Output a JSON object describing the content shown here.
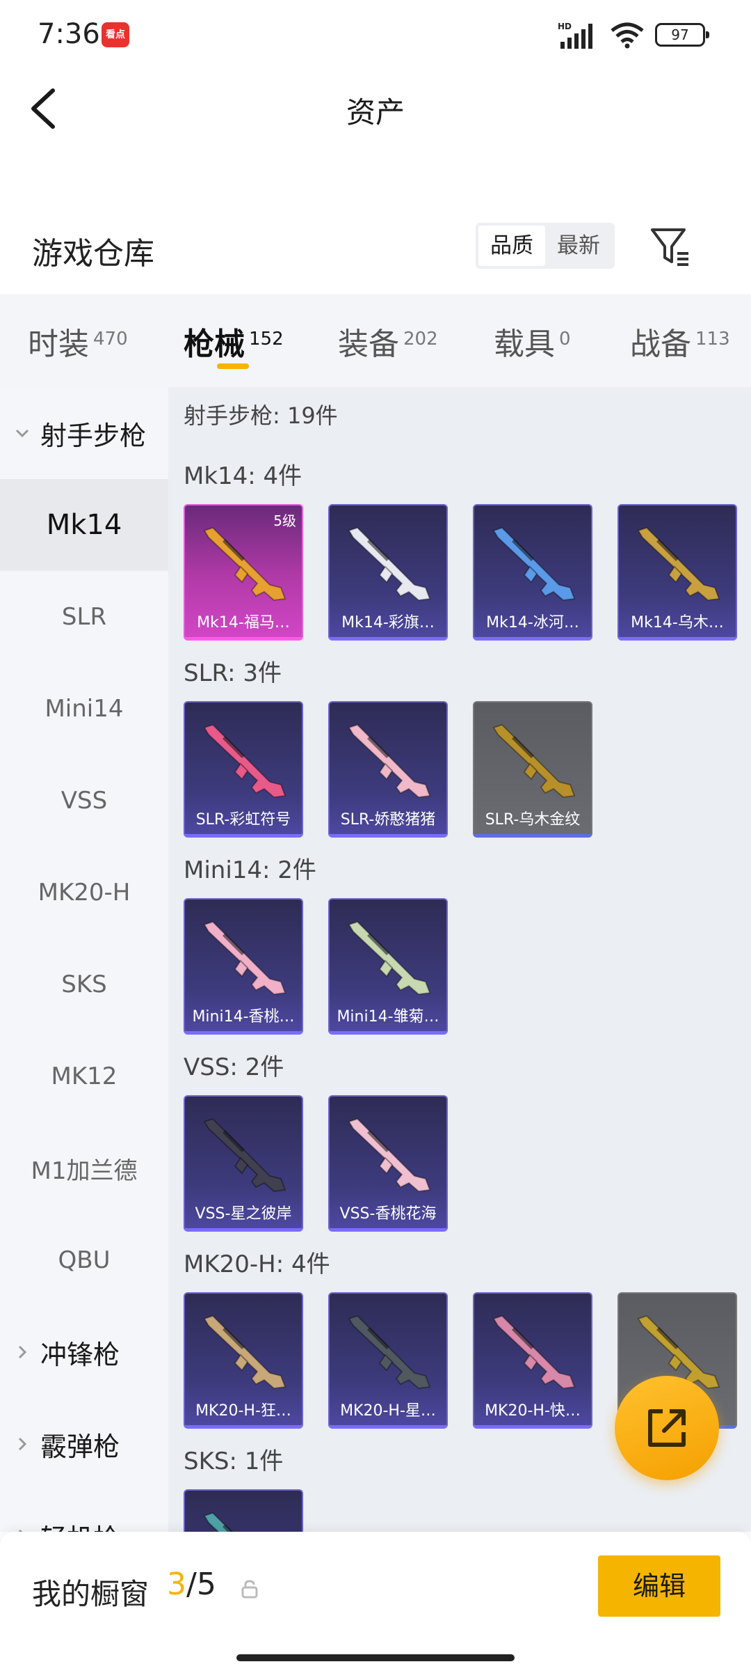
{
  "status_bar": {
    "time": "7:36",
    "news_app_label": "看点",
    "battery": "97",
    "icons": [
      "hd-signal-icon",
      "wifi-icon",
      "battery-icon"
    ]
  },
  "header": {
    "title": "资产",
    "back_icon": "chevron-left-icon"
  },
  "warehouse": {
    "title": "游戏仓库",
    "sort_options": [
      "品质",
      "最新"
    ],
    "sort_selected": "品质",
    "filter_icon": "filter-icon"
  },
  "tabs": [
    {
      "label": "时装",
      "count": "470"
    },
    {
      "label": "枪械",
      "count": "152"
    },
    {
      "label": "装备",
      "count": "202"
    },
    {
      "label": "载具",
      "count": "0"
    },
    {
      "label": "战备",
      "count": "113"
    }
  ],
  "active_tab": "枪械",
  "sidebar": {
    "groups": [
      {
        "label": "射手步枪",
        "expanded": true
      },
      {
        "label": "冲锋枪",
        "expanded": false
      },
      {
        "label": "霰弹枪",
        "expanded": false
      },
      {
        "label": "轻机枪",
        "expanded": false
      }
    ],
    "items": [
      "Mk14",
      "SLR",
      "Mini14",
      "VSS",
      "MK20-H",
      "SKS",
      "MK12",
      "M1加兰德",
      "QBU"
    ],
    "active_item": "Mk14"
  },
  "content": {
    "section_title": "射手步枪: 19件",
    "groups": [
      {
        "title": "Mk14: 4件",
        "cards": [
          {
            "name": "Mk14-福马…",
            "level": "5级",
            "rarity": "pink",
            "gun_color": "#e8a030"
          },
          {
            "name": "Mk14-彩旗…",
            "rarity": "purple",
            "gun_color": "#e8e8f0"
          },
          {
            "name": "Mk14-冰河…",
            "rarity": "purple",
            "gun_color": "#5a9ae8"
          },
          {
            "name": "Mk14-乌木…",
            "rarity": "purple",
            "gun_color": "#c8a040"
          }
        ]
      },
      {
        "title": "SLR: 3件",
        "cards": [
          {
            "name": "SLR-彩虹符号",
            "rarity": "purple",
            "gun_color": "#e85a8a"
          },
          {
            "name": "SLR-娇憨猪猪",
            "rarity": "purple",
            "gun_color": "#f0b8c8"
          },
          {
            "name": "SLR-乌木金纹",
            "rarity": "gray",
            "gun_color": "#b8902a"
          }
        ]
      },
      {
        "title": "Mini14: 2件",
        "cards": [
          {
            "name": "Mini14-香桃…",
            "rarity": "purple",
            "gun_color": "#f0b0c8"
          },
          {
            "name": "Mini14-雏菊…",
            "rarity": "purple",
            "gun_color": "#c8d8b0"
          }
        ]
      },
      {
        "title": "VSS: 2件",
        "cards": [
          {
            "name": "VSS-星之彼岸",
            "rarity": "purple",
            "gun_color": "#404050"
          },
          {
            "name": "VSS-香桃花海",
            "rarity": "purple",
            "gun_color": "#f0c0d0"
          }
        ]
      },
      {
        "title": "MK20-H: 4件",
        "cards": [
          {
            "name": "MK20-H-狂…",
            "rarity": "purple",
            "gun_color": "#c8a878"
          },
          {
            "name": "MK20-H-星…",
            "rarity": "purple",
            "gun_color": "#505860"
          },
          {
            "name": "MK20-H-快…",
            "rarity": "purple",
            "gun_color": "#d888a8"
          },
          {
            "name": "…",
            "rarity": "gray",
            "gun_color": "#c0a030"
          }
        ]
      },
      {
        "title": "SKS: 1件",
        "cards": [
          {
            "name": "",
            "rarity": "purple",
            "gun_color": "#50a0a8"
          }
        ]
      }
    ]
  },
  "fab_icon": "share-external-icon",
  "bottom_bar": {
    "label": "我的橱窗",
    "current": "3",
    "separator_total": "/5",
    "lock_icon": "lock-icon",
    "edit_label": "编辑"
  },
  "colors": {
    "accent": "#f5b400",
    "purple_card": "#3e3b7e",
    "pink_card": "#b23aa8",
    "gray_card": "#6a6c72"
  }
}
